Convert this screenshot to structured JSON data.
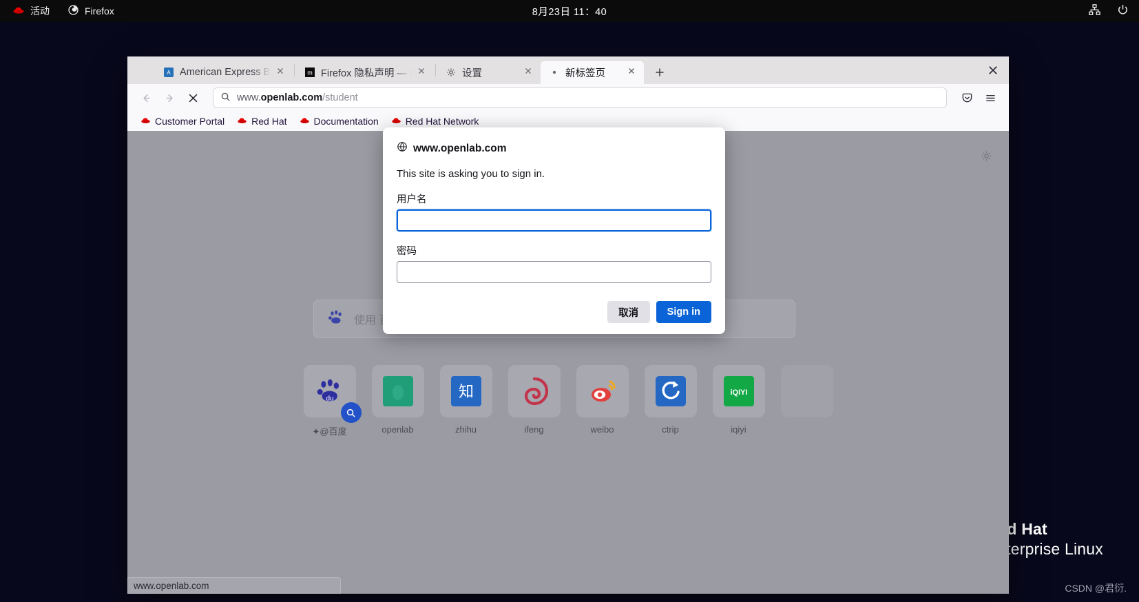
{
  "topbar": {
    "activities_label": "活动",
    "app_label": "Firefox",
    "clock": "8月23日  11：40",
    "redhat_icon": "redhat-logo-icon",
    "firefox_icon": "firefox-logo-icon",
    "network_icon": "network-icon",
    "power_icon": "power-icon"
  },
  "browser": {
    "tabs": [
      {
        "title": "American Express Busines",
        "favicon": "amex-favicon",
        "active": false
      },
      {
        "title": "Firefox 隐私声明 — Mozill",
        "favicon": "mozilla-favicon",
        "active": false
      },
      {
        "title": "设置",
        "favicon": "gear-favicon",
        "active": false
      },
      {
        "title": "新标签页",
        "favicon": "dot-favicon",
        "active": true
      }
    ],
    "new_tab_label": "+",
    "window_close_label": "✕",
    "nav": {
      "back_icon": "back-arrow-icon",
      "forward_icon": "forward-arrow-icon",
      "stop_icon": "stop-loading-icon",
      "search_icon": "search-icon",
      "url_prefix": "www.",
      "url_domain": "openlab.com",
      "url_path": "/student",
      "pocket_icon": "pocket-icon",
      "menu_icon": "hamburger-menu-icon"
    },
    "bookmarks": [
      {
        "label": "Customer Portal",
        "icon": "redhat-bookmark-icon"
      },
      {
        "label": "Red Hat",
        "icon": "redhat-bookmark-icon"
      },
      {
        "label": "Documentation",
        "icon": "redhat-bookmark-icon"
      },
      {
        "label": "Red Hat Network",
        "icon": "redhat-bookmark-icon"
      }
    ],
    "status_text": "www.openlab.com"
  },
  "newtab": {
    "gear_icon": "settings-gear-icon",
    "search_placeholder": "使用 百度 搜索，或输入网址",
    "search_icon": "baidu-search-icon",
    "tiles": [
      {
        "label": "✦@百度",
        "icon": "baidu-icon",
        "badge": "search-badge-icon"
      },
      {
        "label": "openlab",
        "icon": "openlab-icon",
        "badge": ""
      },
      {
        "label": "zhihu",
        "icon": "zhihu-icon",
        "badge": ""
      },
      {
        "label": "ifeng",
        "icon": "ifeng-icon",
        "badge": ""
      },
      {
        "label": "weibo",
        "icon": "weibo-icon",
        "badge": ""
      },
      {
        "label": "ctrip",
        "icon": "ctrip-icon",
        "badge": ""
      },
      {
        "label": "iqiyi",
        "icon": "iqiyi-icon",
        "badge": ""
      },
      {
        "label": "",
        "icon": "empty-tile",
        "badge": ""
      }
    ]
  },
  "auth_dialog": {
    "globe_icon": "globe-icon",
    "host": "www.openlab.com",
    "message": "This site is asking you to sign in.",
    "username_label": "用户名",
    "username_value": "",
    "password_label": "密码",
    "password_value": "",
    "cancel_label": "取消",
    "signin_label": "Sign in"
  },
  "desktop": {
    "wallpaper_line1": "Red Hat",
    "wallpaper_line2": "Enterprise Linux",
    "watermark": "CSDN @君衍."
  },
  "colors": {
    "accent_blue": "#0a64d8",
    "redhat_red": "#ee0000",
    "topbar_bg": "#0b0b0b",
    "content_gray": "#9b9ba3"
  }
}
